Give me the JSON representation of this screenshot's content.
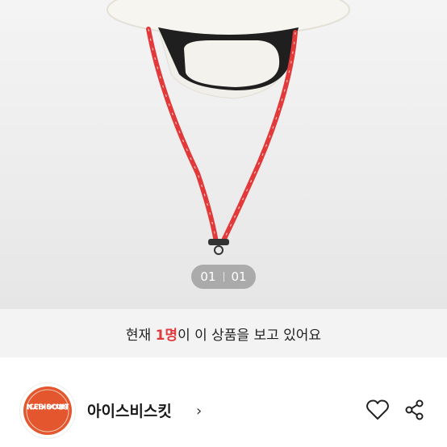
{
  "gallery": {
    "current": "01",
    "total": "01"
  },
  "viewers": {
    "prefix": "현재 ",
    "count": "1명",
    "suffix": "이 이 상품을 보고 있어요"
  },
  "shop": {
    "name": "아이스비스킷",
    "chevron": "›",
    "logo_text_top": "ICEBISCUIT",
    "logo_text_bottom": "BROOKLYN"
  },
  "colors": {
    "accent": "#e0393e",
    "lanyard": "#e23a3a"
  },
  "icons": [
    "heart-icon",
    "share-icon",
    "chevron-right-icon"
  ]
}
